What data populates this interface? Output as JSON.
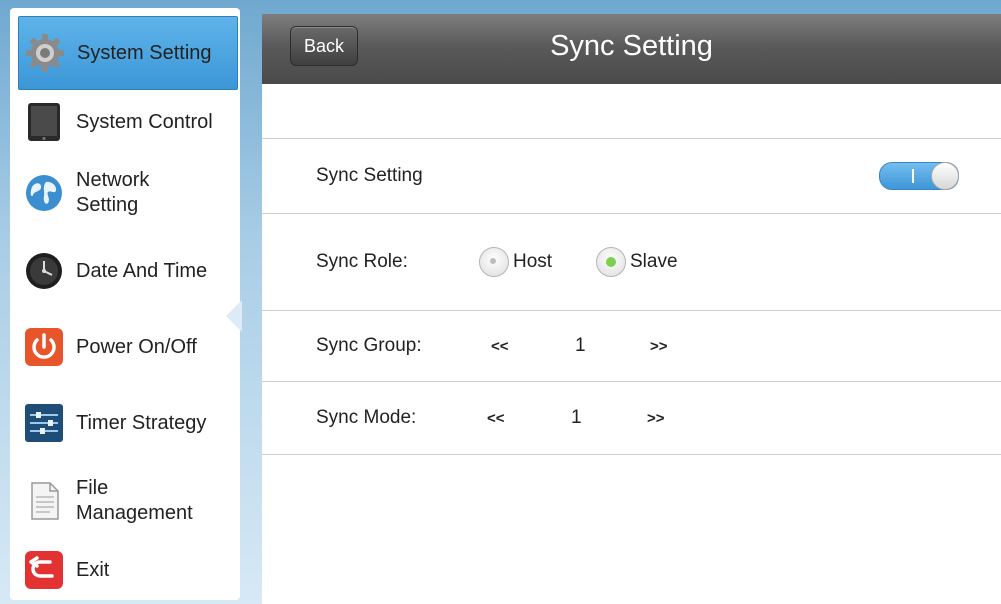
{
  "sidebar": {
    "items": [
      {
        "label": "System Setting",
        "icon": "gear-icon",
        "active": true
      },
      {
        "label": "System Control",
        "icon": "tablet-icon"
      },
      {
        "label": "Network Setting",
        "icon": "globe-icon"
      },
      {
        "label": "Date And Time",
        "icon": "clock-icon"
      },
      {
        "label": "Power On/Off",
        "icon": "power-icon"
      },
      {
        "label": "Timer Strategy",
        "icon": "sliders-icon"
      },
      {
        "label": "File Management",
        "icon": "document-icon"
      },
      {
        "label": "Exit",
        "icon": "exit-icon"
      }
    ]
  },
  "header": {
    "back_label": "Back",
    "title": "Sync Setting"
  },
  "settings": {
    "sync_setting": {
      "label": "Sync Setting",
      "enabled": true,
      "toggle_text": "I"
    },
    "sync_role": {
      "label": "Sync Role:",
      "options": [
        {
          "label": "Host",
          "selected": false
        },
        {
          "label": "Slave",
          "selected": true
        }
      ]
    },
    "sync_group": {
      "label": "Sync Group:",
      "prev": "<<",
      "value": "1",
      "next": ">>"
    },
    "sync_mode": {
      "label": "Sync Mode:",
      "prev": "<<",
      "value": "1",
      "next": ">>"
    }
  },
  "colors": {
    "accent": "#3c97d7",
    "radio_selected": "#7dcf4e",
    "header_bg": "#5a5a5a"
  }
}
